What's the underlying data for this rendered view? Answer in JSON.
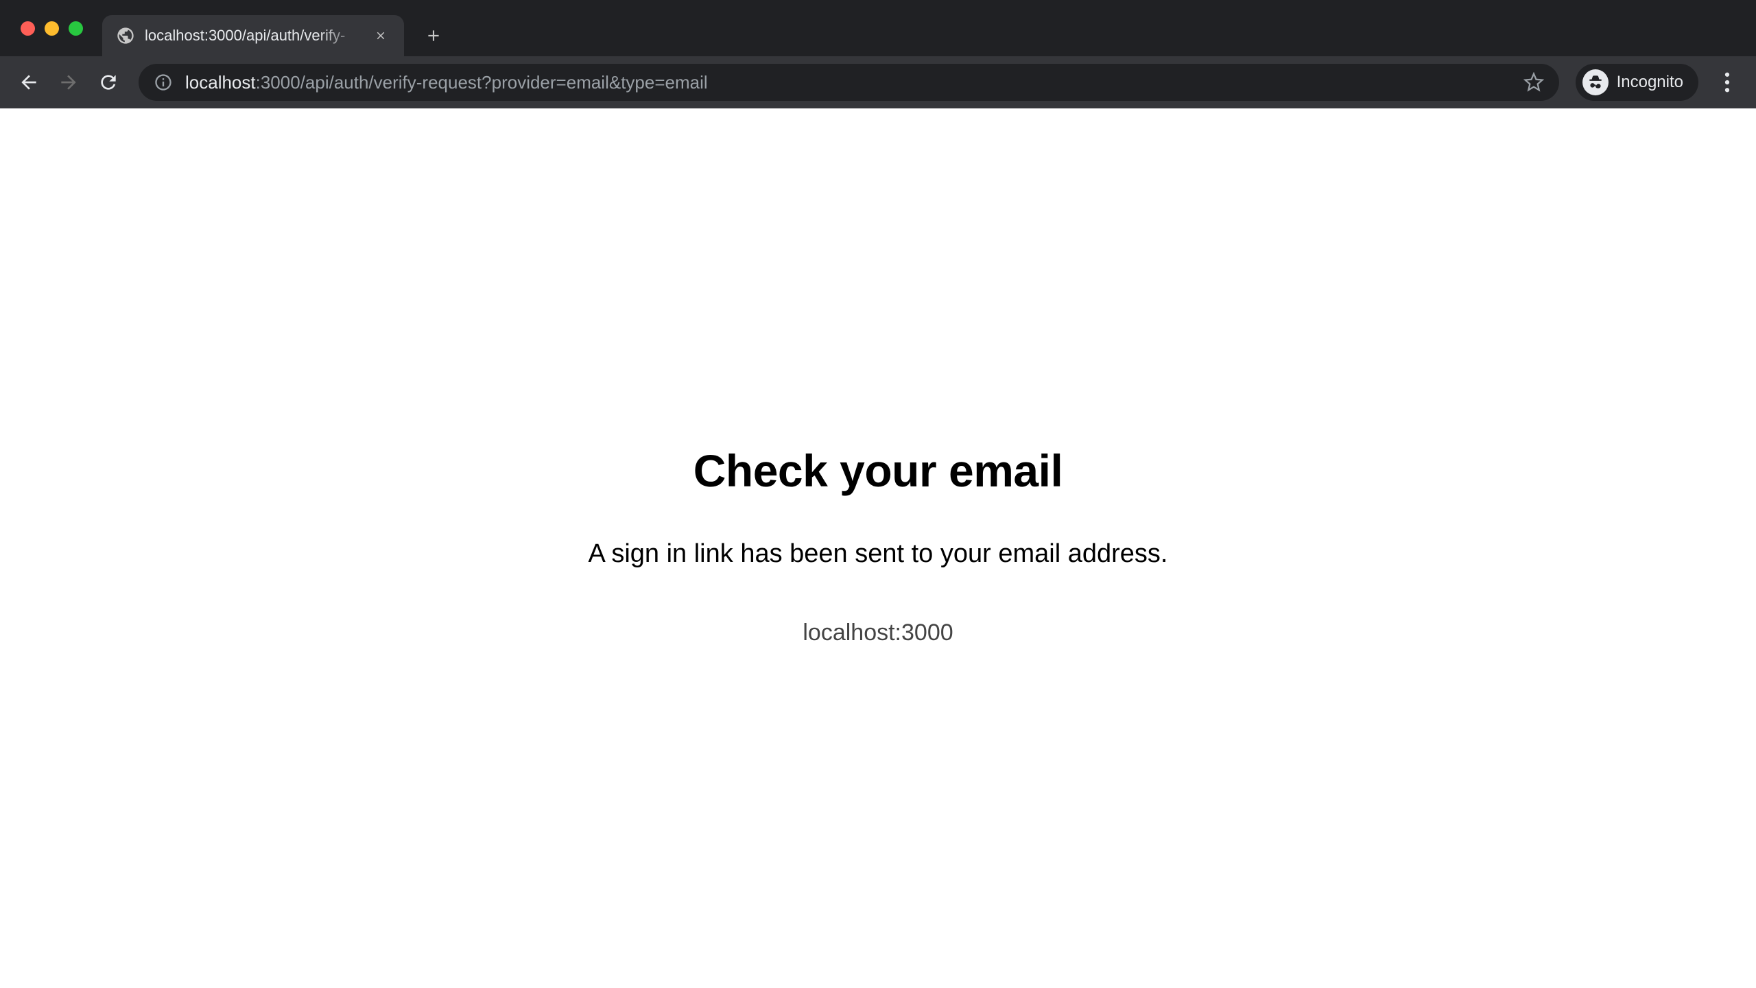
{
  "browser": {
    "tab_title": "localhost:3000/api/auth/verify-",
    "url_host": "localhost",
    "url_path": ":3000/api/auth/verify-request?provider=email&type=email",
    "incognito_label": "Incognito"
  },
  "page": {
    "heading": "Check your email",
    "message": "A sign in link has been sent to your email address.",
    "host": "localhost:3000"
  }
}
